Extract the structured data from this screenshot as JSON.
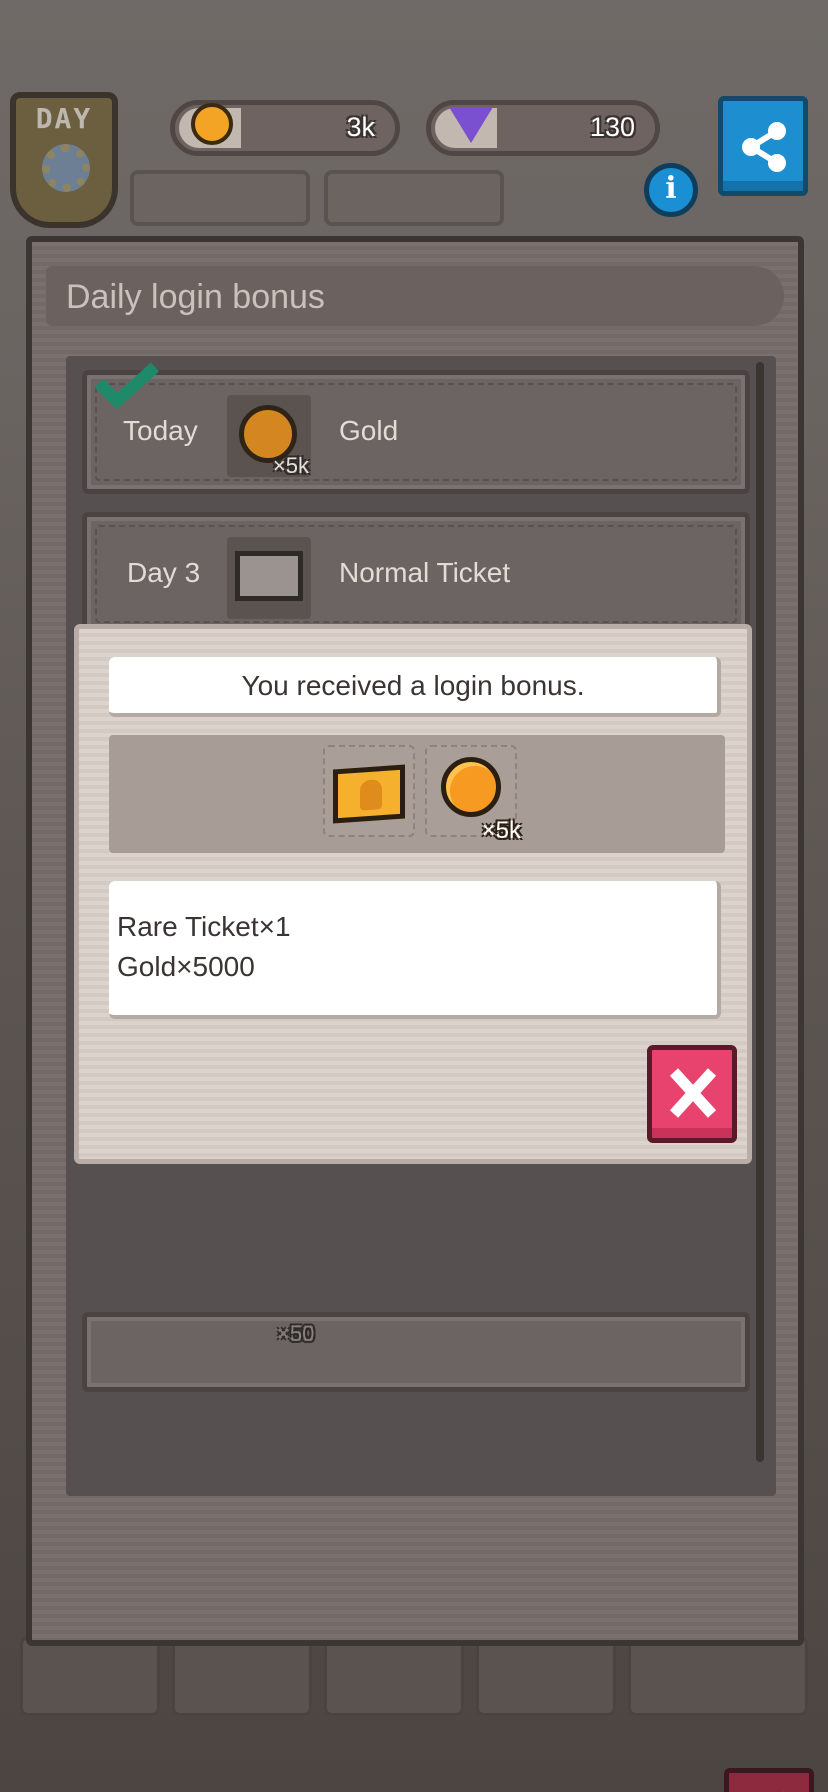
{
  "hud": {
    "day_badge": "DAY",
    "gold_amount": "3k",
    "gem_amount": "130",
    "icons": {
      "gold": "gold-coin-icon",
      "gem": "purple-gem-icon",
      "share": "share-icon",
      "info": "info-icon"
    },
    "info_glyph": "i"
  },
  "panel": {
    "title": "Daily login bonus",
    "rows": [
      {
        "day": "Today",
        "item": "Gold",
        "multiplier": "×5k",
        "claimed": true
      },
      {
        "day": "Day 3",
        "item": "Normal Ticket"
      }
    ],
    "hidden_row_multiplier": "×50"
  },
  "popup": {
    "message": "You received a login bonus.",
    "rewards": [
      {
        "icon": "rare-ticket-icon"
      },
      {
        "icon": "gold-coin-icon",
        "multiplier": "×5k"
      }
    ],
    "details": [
      "Rare Ticket×1",
      "Gold×5000"
    ]
  },
  "colors": {
    "share_button": "#1d8fd1",
    "popup_close": "#e8436e",
    "panel_close": "#8e2a3e",
    "check": "#1f8a6a"
  }
}
